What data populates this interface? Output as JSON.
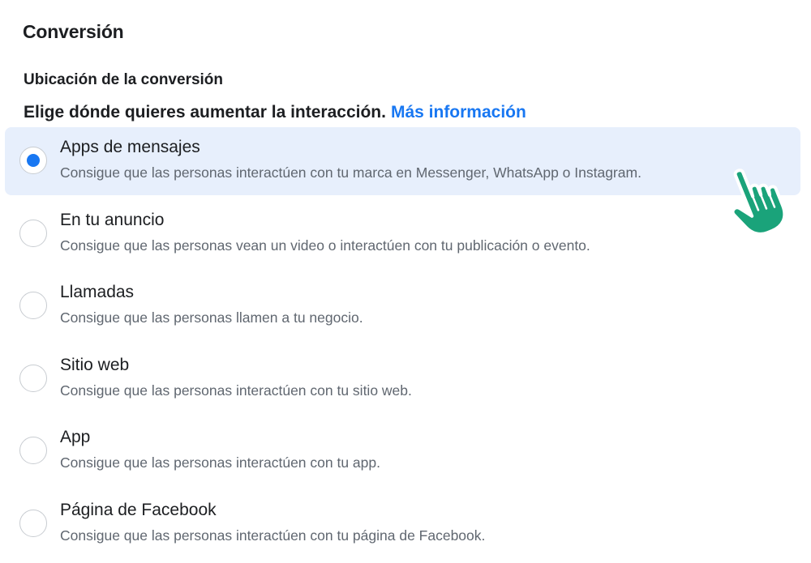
{
  "section": {
    "title": "Conversión"
  },
  "conversion_location": {
    "title": "Ubicación de la conversión",
    "helper_text": "Elige dónde quieres aumentar la interacción.",
    "more_info_link": "Más información"
  },
  "options": [
    {
      "label": "Apps de mensajes",
      "description": "Consigue que las personas interactúen con tu marca en Messenger, WhatsApp o Instagram.",
      "selected": true
    },
    {
      "label": "En tu anuncio",
      "description": "Consigue que las personas vean un video o interactúen con tu publicación o evento.",
      "selected": false
    },
    {
      "label": "Llamadas",
      "description": "Consigue que las personas llamen a tu negocio.",
      "selected": false
    },
    {
      "label": "Sitio web",
      "description": "Consigue que las personas interactúen con tu sitio web.",
      "selected": false
    },
    {
      "label": "App",
      "description": "Consigue que las personas interactúen con tu app.",
      "selected": false
    },
    {
      "label": "Página de Facebook",
      "description": "Consigue que las personas interactúen con tu página de Facebook.",
      "selected": false
    }
  ],
  "colors": {
    "accent": "#1877f2",
    "selected_background": "#e7effc",
    "cursor": "#1aa37a"
  },
  "icons": {
    "cursor": "pointing-hand-cursor-icon"
  }
}
